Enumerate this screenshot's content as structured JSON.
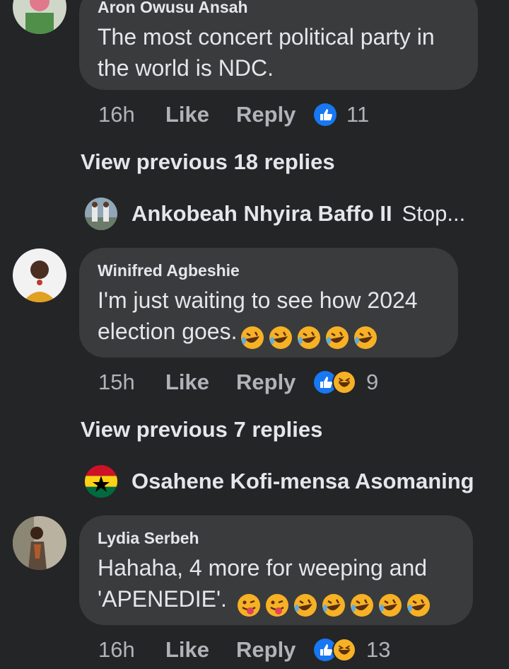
{
  "comments": [
    {
      "author": "Aron Owusu Ansah",
      "text": "The most concert political party in the world is NDC.",
      "line1": "The most concert political party in",
      "line2": "the world is NDC.",
      "time": "16h",
      "like_label": "Like",
      "reply_label": "Reply",
      "reactions": [
        "like"
      ],
      "reaction_count": "11"
    },
    {
      "author": "Winifred Agbeshie",
      "line1": "I'm just waiting to see how 2024",
      "line2": "election goes.",
      "emojis": [
        "rofl-emoji",
        "rofl-emoji",
        "rofl-emoji",
        "rofl-emoji",
        "rofl-emoji"
      ],
      "time": "15h",
      "like_label": "Like",
      "reply_label": "Reply",
      "reactions": [
        "like",
        "haha"
      ],
      "reaction_count": "9"
    },
    {
      "author": "Lydia Serbeh",
      "line1": "Hahaha, 4 more for weeping and",
      "line2": "'APENEDIE'.",
      "emojis": [
        "tongue-emoji",
        "tongue-emoji",
        "rofl-emoji",
        "rofl-emoji",
        "rofl-emoji",
        "rofl-emoji",
        "rofl-emoji"
      ],
      "time": "16h",
      "like_label": "Like",
      "reply_label": "Reply",
      "reactions": [
        "like",
        "haha"
      ],
      "reaction_count": "13"
    }
  ],
  "view_previous": [
    {
      "label": "View previous 18 replies"
    },
    {
      "label": "View previous 7 replies"
    }
  ],
  "collapsed_replies": [
    {
      "name": "Ankobeah Nhyira Baffo II",
      "snippet": "Stop..."
    },
    {
      "name": "Osahene Kofi-mensa Asomaning",
      "snippet": ""
    }
  ],
  "colors": {
    "background": "#242526",
    "bubble": "#3a3b3c",
    "text": "#e4e6eb",
    "secondary_text": "#b0b3b8",
    "like_blue": "#1877f2",
    "haha_yellow": "#f7b125"
  }
}
